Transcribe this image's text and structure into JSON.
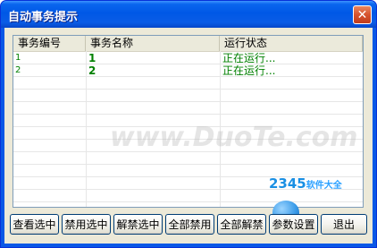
{
  "window": {
    "title": "自动事务提示",
    "close_label": "✕"
  },
  "listview": {
    "columns": [
      "事务编号",
      "事务名称",
      "运行状态"
    ],
    "rows": [
      {
        "id": "1",
        "name": "1",
        "status": "正在运行..."
      },
      {
        "id": "2",
        "name": "2",
        "status": "正在运行..."
      }
    ],
    "row_color": "#008000"
  },
  "buttons": {
    "view_selected": "查看选中",
    "disable_selected": "禁用选中",
    "enable_selected": "解禁选中",
    "disable_all": "全部禁用",
    "enable_all": "全部解禁",
    "settings": "参数设置",
    "exit": "退出"
  },
  "watermark": "www.DuoTe.com",
  "logo": {
    "brand": "2345",
    "suffix": "软件大全"
  },
  "colors": {
    "titlebar": "#0058e6",
    "close": "#d6532e",
    "dialog_bg": "#ece9d8"
  }
}
